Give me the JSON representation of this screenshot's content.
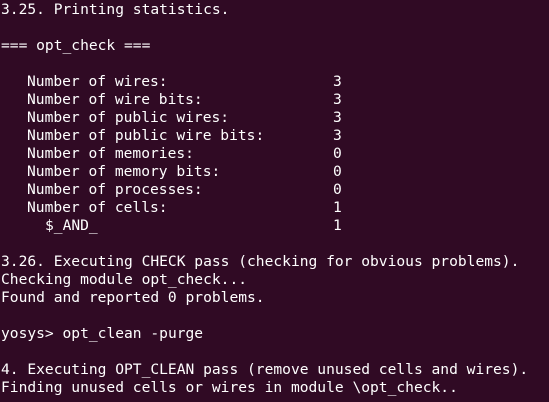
{
  "terminal": {
    "section_325": "3.25. Printing statistics.",
    "module_header": "=== opt_check ===",
    "stats": [
      {
        "label": "Number of wires:",
        "value": "3"
      },
      {
        "label": "Number of wire bits:",
        "value": "3"
      },
      {
        "label": "Number of public wires:",
        "value": "3"
      },
      {
        "label": "Number of public wire bits:",
        "value": "3"
      },
      {
        "label": "Number of memories:",
        "value": "0"
      },
      {
        "label": "Number of memory bits:",
        "value": "0"
      },
      {
        "label": "Number of processes:",
        "value": "0"
      },
      {
        "label": "Number of cells:",
        "value": "1"
      }
    ],
    "cell_type": {
      "label": "$_AND_",
      "value": "1"
    },
    "section_326": "3.26. Executing CHECK pass (checking for obvious problems).",
    "checking_module": "Checking module opt_check...",
    "found_problems": "Found and reported 0 problems.",
    "prompt": "yosys>",
    "command": "opt_clean -purge",
    "section_4": "4. Executing OPT_CLEAN pass (remove unused cells and wires).",
    "finding_unused": "Finding unused cells or wires in module \\opt_check.."
  }
}
